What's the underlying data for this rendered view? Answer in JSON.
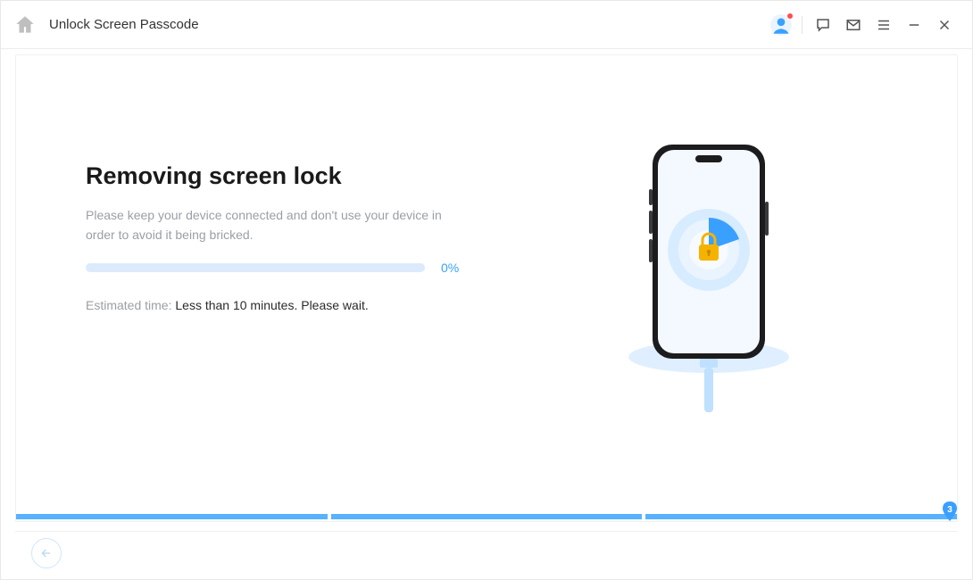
{
  "header": {
    "title": "Unlock Screen Passcode"
  },
  "main": {
    "heading": "Removing screen lock",
    "description": "Please keep your device connected and don't use your device in order to avoid it being bricked.",
    "progress_percent_label": "0%",
    "progress_percent_value": 0,
    "eta_prefix": "Estimated time: ",
    "eta_value": "Less than 10 minutes. Please wait."
  },
  "steps": {
    "current_index": 3,
    "badge_label": "3"
  },
  "colors": {
    "accent": "#3aa0ff",
    "progress_track": "#dcebfb"
  }
}
